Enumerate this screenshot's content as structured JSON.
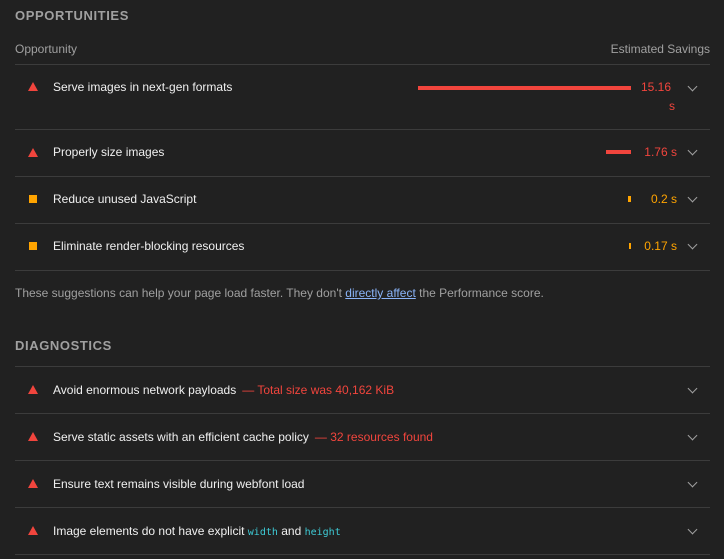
{
  "opportunities": {
    "title": "OPPORTUNITIES",
    "column_left": "Opportunity",
    "column_right": "Estimated Savings",
    "items": [
      {
        "severity": "fail",
        "label": "Serve images in next-gen formats",
        "savings_line1": "15.16",
        "savings_line2": "s",
        "bar_fraction": 1.0
      },
      {
        "severity": "fail",
        "label": "Properly size images",
        "savings": "1.76 s",
        "bar_fraction": 0.116
      },
      {
        "severity": "average",
        "label": "Reduce unused JavaScript",
        "savings": "0.2 s",
        "bar_fraction": 0.013
      },
      {
        "severity": "average",
        "label": "Eliminate render-blocking resources",
        "savings": "0.17 s",
        "bar_fraction": 0.011
      }
    ],
    "note_prefix": "These suggestions can help your page load faster. They don't ",
    "note_link": "directly affect",
    "note_suffix": " the Performance score."
  },
  "diagnostics": {
    "title": "DIAGNOSTICS",
    "items": [
      {
        "severity": "fail",
        "label": "Avoid enormous network payloads",
        "display": "— Total size was 40,162 KiB"
      },
      {
        "severity": "fail",
        "label": "Serve static assets with an efficient cache policy",
        "display": "— 32 resources found"
      },
      {
        "severity": "fail",
        "label": "Ensure text remains visible during webfont load",
        "display": ""
      },
      {
        "severity": "fail",
        "label_prefix": "Image elements do not have explicit ",
        "code1": "width",
        "label_mid": " and ",
        "code2": "height"
      }
    ]
  },
  "colors": {
    "fail": "#f1453d",
    "average": "#ffa400",
    "link": "#8ab4f8",
    "code": "#3ecbd6"
  },
  "icons": {
    "fail": "triangle-fail-icon",
    "average": "square-average-icon",
    "expand": "chevron-down-icon"
  }
}
